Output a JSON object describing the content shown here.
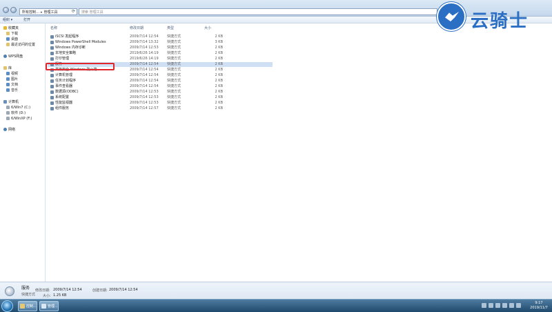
{
  "address_bar": {
    "segments": [
      "所有控制…",
      "管理工具"
    ],
    "search_placeholder": "搜索 管理工具"
  },
  "toolbar": {
    "organize_label": "组织 ▾",
    "open_label": "打开"
  },
  "sidebar": {
    "favorites_header": "收藏夹",
    "favorites": [
      "下载",
      "桌面",
      "最近访问的位置"
    ],
    "wps_label": "WPS网盘",
    "libraries_header": "库",
    "libraries": [
      "视频",
      "图片",
      "文档",
      "音乐"
    ],
    "computer_header": "计算机",
    "drives": [
      "6/Win7 (C:)",
      "软件 (D:)",
      "6/WinXP (F:)"
    ],
    "network_label": "网络"
  },
  "columns": {
    "name": "名称",
    "date": "修改日期",
    "type": "类型",
    "size": "大小"
  },
  "files": [
    {
      "name": "iSCSI 发起程序",
      "date": "2009/7/14 12:54",
      "type": "快捷方式",
      "size": "2 KB"
    },
    {
      "name": "Windows PowerShell Modules",
      "date": "2009/7/14 13:32",
      "type": "快捷方式",
      "size": "3 KB"
    },
    {
      "name": "Windows 内存诊断",
      "date": "2009/7/14 12:53",
      "type": "快捷方式",
      "size": "2 KB"
    },
    {
      "name": "本地安全策略",
      "date": "2019/6/26 14:19",
      "type": "快捷方式",
      "size": "2 KB"
    },
    {
      "name": "打印管理",
      "date": "2019/6/26 14:19",
      "type": "快捷方式",
      "size": "2 KB"
    },
    {
      "name": "服务",
      "date": "2009/7/14 12:54",
      "type": "快捷方式",
      "size": "2 KB"
    },
    {
      "name": "高级安全 Windows 防火墙",
      "date": "2009/7/14 12:54",
      "type": "快捷方式",
      "size": "2 KB"
    },
    {
      "name": "计算机管理",
      "date": "2009/7/14 12:54",
      "type": "快捷方式",
      "size": "2 KB"
    },
    {
      "name": "任务计划程序",
      "date": "2009/7/14 12:54",
      "type": "快捷方式",
      "size": "2 KB"
    },
    {
      "name": "事件查看器",
      "date": "2009/7/14 12:54",
      "type": "快捷方式",
      "size": "2 KB"
    },
    {
      "name": "数据源(ODBC)",
      "date": "2009/7/14 12:53",
      "type": "快捷方式",
      "size": "2 KB"
    },
    {
      "name": "系统配置",
      "date": "2009/7/14 12:53",
      "type": "快捷方式",
      "size": "2 KB"
    },
    {
      "name": "性能监视器",
      "date": "2009/7/14 12:53",
      "type": "快捷方式",
      "size": "2 KB"
    },
    {
      "name": "组件服务",
      "date": "2009/7/14 12:57",
      "type": "快捷方式",
      "size": "2 KB"
    }
  ],
  "details": {
    "name": "服务",
    "type": "快捷方式",
    "modified_label": "修改日期:",
    "modified_value": "2009/7/14 12:54",
    "size_label": "大小:",
    "size_value": "1.25 KB",
    "created_label": "创建日期:",
    "created_value": "2009/7/14 12:54"
  },
  "taskbar": {
    "tasks": [
      "控制...",
      "管理..."
    ],
    "time": "9:17",
    "date": "2019/11/7"
  },
  "watermark": {
    "text": "云骑士"
  },
  "colors": {
    "highlight_box": "#e0252b",
    "selection": "#cfe0f4",
    "logo_blue": "#2b6fc4"
  }
}
